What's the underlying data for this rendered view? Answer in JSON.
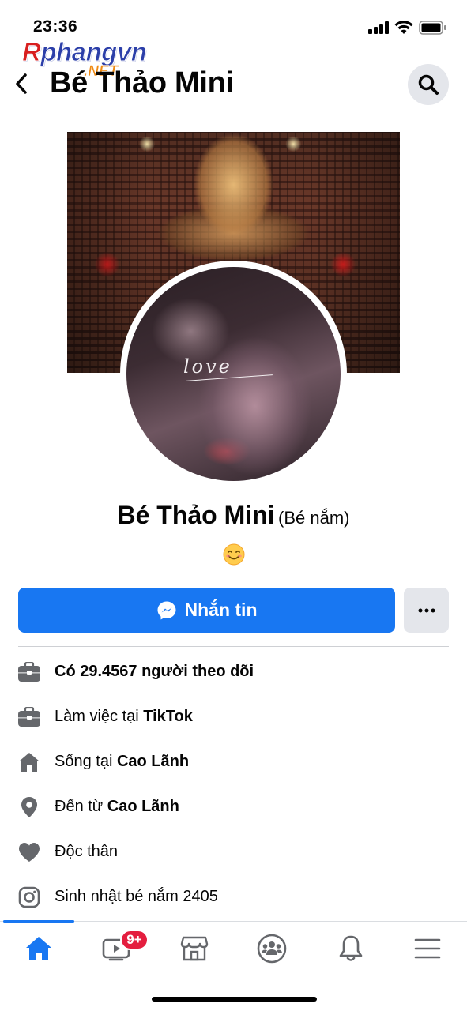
{
  "status_bar": {
    "time": "23:36"
  },
  "watermark": {
    "brand": "Rphangvn",
    "suffix": ".NET"
  },
  "header": {
    "title": "Bé Thảo Mini"
  },
  "profile": {
    "name": "Bé Thảo Mini",
    "nickname": "(Bé nắm)",
    "photo_caption": "love",
    "bio_emoji": "smiling-face-icon"
  },
  "actions": {
    "message_label": "Nhắn tin",
    "more_label": "···"
  },
  "details": [
    {
      "icon": "briefcase-icon",
      "prefix": "Có ",
      "bold": "29.4567 người theo dõi",
      "full_bold": true
    },
    {
      "icon": "briefcase-icon",
      "prefix": "Làm việc tại ",
      "bold": "TikTok",
      "full_bold": false
    },
    {
      "icon": "home-icon",
      "prefix": "Sống tại ",
      "bold": "Cao Lãnh",
      "full_bold": false
    },
    {
      "icon": "location-pin-icon",
      "prefix": "Đến từ ",
      "bold": "Cao Lãnh",
      "full_bold": false
    },
    {
      "icon": "heart-icon",
      "prefix": "Độc thân",
      "bold": "",
      "full_bold": false
    },
    {
      "icon": "instagram-icon",
      "prefix": "Sinh nhật bé nắm 2405",
      "bold": "",
      "full_bold": false
    }
  ],
  "bottom_nav": {
    "items": [
      "home-icon",
      "watch-video-icon",
      "marketplace-icon",
      "groups-icon",
      "notifications-bell-icon",
      "menu-icon"
    ],
    "active": "home-icon",
    "watch_badge": "9+"
  },
  "colors": {
    "accent": "#1877f2",
    "badge": "#e41e3f",
    "secondary_button": "#e4e6eb",
    "icon_gray": "#65676b"
  }
}
